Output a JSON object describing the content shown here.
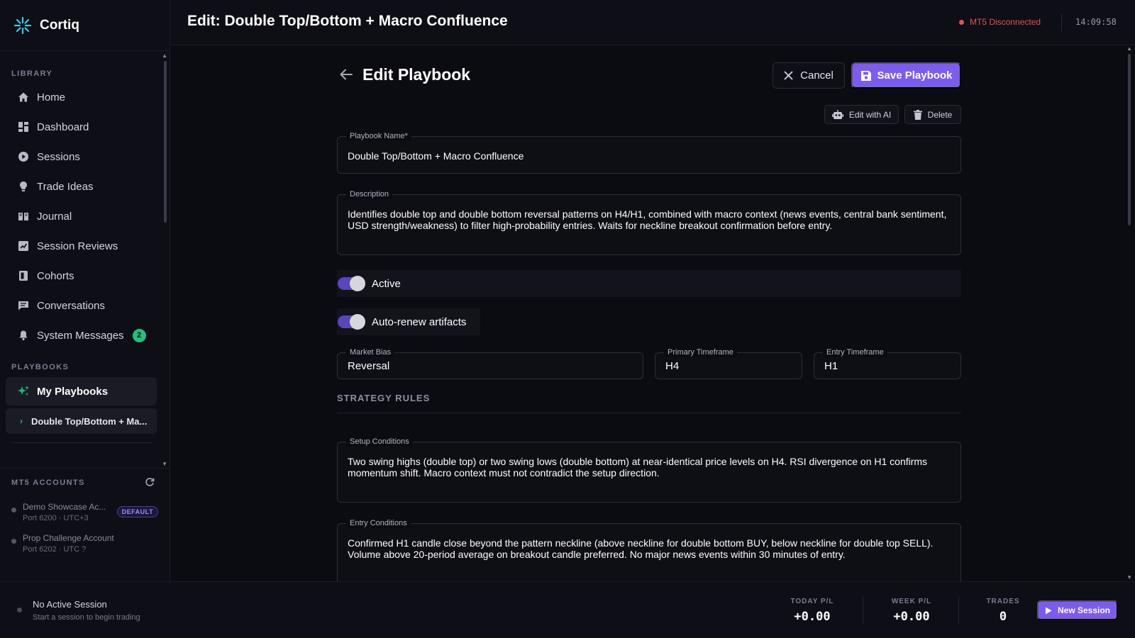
{
  "app": {
    "name": "Cortiq"
  },
  "sidebar": {
    "library_title": "LIBRARY",
    "library_items": [
      {
        "label": "Home",
        "icon": "home-icon"
      },
      {
        "label": "Dashboard",
        "icon": "dashboard-icon"
      },
      {
        "label": "Sessions",
        "icon": "play-circle-icon"
      },
      {
        "label": "Trade Ideas",
        "icon": "lightbulb-icon"
      },
      {
        "label": "Journal",
        "icon": "book-icon"
      },
      {
        "label": "Session Reviews",
        "icon": "review-icon"
      },
      {
        "label": "Cohorts",
        "icon": "cohorts-icon"
      },
      {
        "label": "Conversations",
        "icon": "chat-icon"
      },
      {
        "label": "System Messages",
        "icon": "bell-icon",
        "badge": "2"
      }
    ],
    "playbooks_title": "PLAYBOOKS",
    "my_playbooks": "My Playbooks",
    "current_playbook": "Double Top/Bottom + Ma...",
    "mt5_title": "MT5 ACCOUNTS",
    "accounts": [
      {
        "name": "Demo Showcase Ac...",
        "meta": "Port 6200 · UTC+3",
        "badge": "DEFAULT"
      },
      {
        "name": "Prop Challenge Account",
        "meta": "Port 6202 · UTC ?"
      }
    ]
  },
  "topbar": {
    "title": "Edit: Double Top/Bottom + Macro Confluence",
    "connection": "MT5 Disconnected",
    "clock": "14:09:58"
  },
  "editor": {
    "heading": "Edit Playbook",
    "cancel_label": "Cancel",
    "save_label": "Save Playbook",
    "edit_ai_label": "Edit with AI",
    "delete_label": "Delete",
    "name_label": "Playbook Name*",
    "name_value": "Double Top/Bottom + Macro Confluence",
    "description_label": "Description",
    "description_value": "Identifies double top and double bottom reversal patterns on H4/H1, combined with macro context (news events, central bank sentiment, USD strength/weakness) to filter high-probability entries. Waits for neckline breakout confirmation before entry.",
    "active_label": "Active",
    "autorenew_label": "Auto-renew artifacts",
    "market_bias_label": "Market Bias",
    "market_bias_value": "Reversal",
    "primary_tf_label": "Primary Timeframe",
    "primary_tf_value": "H4",
    "entry_tf_label": "Entry Timeframe",
    "entry_tf_value": "H1",
    "strategy_title": "STRATEGY RULES",
    "setup_label": "Setup Conditions",
    "setup_value": "Two swing highs (double top) or two swing lows (double bottom) at near-identical price levels on H4. RSI divergence on H1 confirms momentum shift. Macro context must not contradict the setup direction.",
    "entry_label": "Entry Conditions",
    "entry_value": "Confirmed H1 candle close beyond the pattern neckline (above neckline for double bottom BUY, below neckline for double top SELL). Volume above 20-period average on breakout candle preferred. No major news events within 30 minutes of entry."
  },
  "bottombar": {
    "session_title": "No Active Session",
    "session_sub": "Start a session to begin trading",
    "today_label": "TODAY P/L",
    "today_value": "+0.00",
    "week_label": "WEEK P/L",
    "week_value": "+0.00",
    "trades_label": "TRADES",
    "trades_value": "0",
    "new_session_label": "New Session"
  },
  "colors": {
    "accent": "#7c5cf0",
    "success": "#22c07a",
    "danger": "#e0525a"
  }
}
